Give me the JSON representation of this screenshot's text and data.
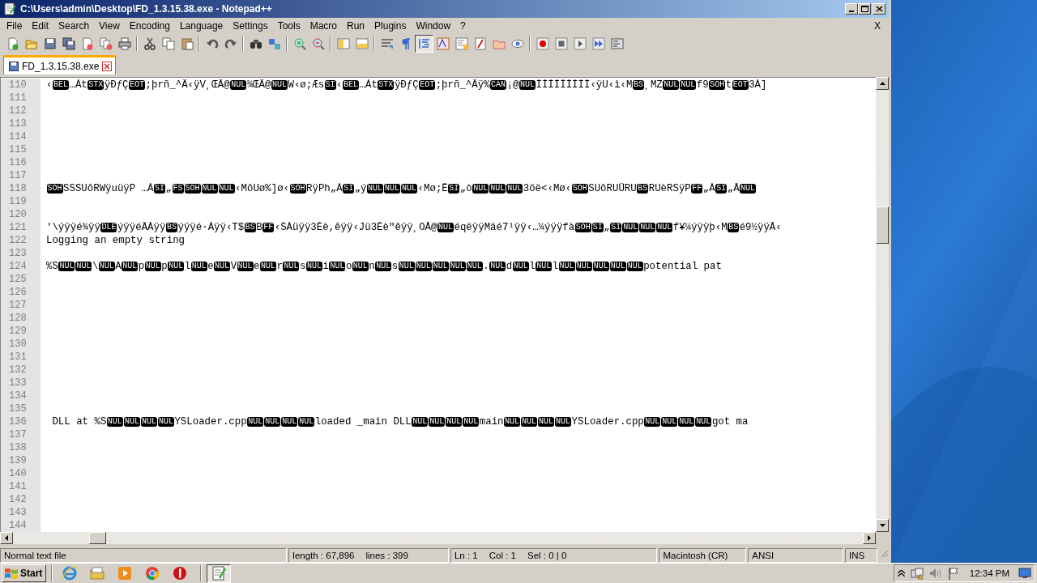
{
  "window": {
    "title": "C:\\Users\\admin\\Desktop\\FD_1.3.15.38.exe - Notepad++"
  },
  "menu": [
    "File",
    "Edit",
    "Search",
    "View",
    "Encoding",
    "Language",
    "Settings",
    "Tools",
    "Macro",
    "Run",
    "Plugins",
    "Window",
    "?"
  ],
  "menu_close": "X",
  "toolbar": [
    {
      "selected": false
    },
    {
      "selected": false
    },
    {
      "selected": false
    },
    {
      "selected": false
    },
    {
      "selected": false
    },
    {
      "selected": false
    },
    {
      "selected": false
    },
    {
      "selected": false
    },
    {
      "selected": false
    },
    {
      "selected": false
    },
    {
      "selected": false
    },
    {
      "selected": false
    },
    {
      "selected": false
    },
    {
      "selected": false
    },
    {
      "selected": false
    },
    {
      "selected": false
    },
    {
      "selected": false
    },
    {
      "selected": false
    },
    {
      "selected": false
    },
    {
      "selected": false
    },
    {
      "selected": true
    },
    {
      "selected": false
    },
    {
      "selected": false
    },
    {
      "selected": false
    },
    {
      "selected": false
    },
    {
      "selected": false
    },
    {
      "selected": false
    },
    {
      "selected": false
    },
    {
      "selected": false
    },
    {
      "selected": false
    },
    {
      "selected": false
    }
  ],
  "tabs": [
    {
      "label": "FD_1.3.15.38.exe",
      "selected": true
    }
  ],
  "lines": [
    {
      "number": "110",
      "segments": [
        {
          "kind": "text",
          "text": "‹"
        },
        {
          "kind": "ctrl",
          "text": "BEL"
        },
        {
          "kind": "text",
          "text": "…Àt"
        },
        {
          "kind": "ctrl",
          "text": "STX"
        },
        {
          "kind": "text",
          "text": "ÿÐƒÇ"
        },
        {
          "kind": "ctrl",
          "text": "EOT"
        },
        {
          "kind": "text",
          "text": ";þrñ_^Ã"
        },
        {
          "kind": "text",
          "text": "‹ÿV¸ŒÃ@"
        },
        {
          "kind": "ctrl",
          "text": "NUL"
        },
        {
          "kind": "text",
          "text": "¾ŒÃ@"
        },
        {
          "kind": "ctrl",
          "text": "NUL"
        },
        {
          "kind": "text",
          "text": "W‹ø;Æs"
        },
        {
          "kind": "ctrl",
          "text": "SI"
        },
        {
          "kind": "text",
          "text": "‹"
        },
        {
          "kind": "ctrl",
          "text": "BEL"
        },
        {
          "kind": "text",
          "text": "…Àt"
        },
        {
          "kind": "ctrl",
          "text": "STX"
        },
        {
          "kind": "text",
          "text": "ÿÐƒÇ"
        },
        {
          "kind": "ctrl",
          "text": "EOT"
        },
        {
          "kind": "text",
          "text": ";þrñ_^Ãÿ%"
        },
        {
          "kind": "ctrl",
          "text": "CAN"
        },
        {
          "kind": "text",
          "text": "¡@"
        },
        {
          "kind": "ctrl",
          "text": "NUL"
        },
        {
          "kind": "text",
          "text": "ÌÌÌÌÌÌÌÌÌ‹ÿU‹ì‹M"
        },
        {
          "kind": "ctrl",
          "text": "BS"
        },
        {
          "kind": "text",
          "text": "¸MZ"
        },
        {
          "kind": "ctrl",
          "text": "NUL"
        },
        {
          "kind": "ctrl",
          "text": "NUL"
        },
        {
          "kind": "text",
          "text": "f9"
        },
        {
          "kind": "ctrl",
          "text": "SOH"
        },
        {
          "kind": "text",
          "text": "t"
        },
        {
          "kind": "ctrl",
          "text": "EOT"
        },
        {
          "kind": "text",
          "text": "3À]"
        }
      ]
    },
    {
      "number": "111"
    },
    {
      "number": "112"
    },
    {
      "number": "113"
    },
    {
      "number": "114"
    },
    {
      "number": "115"
    },
    {
      "number": "116"
    },
    {
      "number": "117"
    },
    {
      "number": "118",
      "segments": [
        {
          "kind": "ctrl",
          "text": "SOH"
        },
        {
          "kind": "text",
          "text": "SSSUôRWÿuüÿP …À"
        },
        {
          "kind": "ctrl",
          "text": "SI"
        },
        {
          "kind": "text",
          "text": "„"
        },
        {
          "kind": "ctrl",
          "text": "FS"
        },
        {
          "kind": "ctrl",
          "text": "SOH"
        },
        {
          "kind": "ctrl",
          "text": "NUL"
        },
        {
          "kind": "ctrl",
          "text": "NUL"
        },
        {
          "kind": "text",
          "text": "‹MôUø%]ø‹"
        },
        {
          "kind": "ctrl",
          "text": "SOH"
        },
        {
          "kind": "text",
          "text": "RÿPh„À"
        },
        {
          "kind": "ctrl",
          "text": "SI"
        },
        {
          "kind": "text",
          "text": "„ý"
        },
        {
          "kind": "ctrl",
          "text": "NUL"
        },
        {
          "kind": "ctrl",
          "text": "NUL"
        },
        {
          "kind": "ctrl",
          "text": "NUL"
        },
        {
          "kind": "text",
          "text": "‹Mø;Ë"
        },
        {
          "kind": "ctrl",
          "text": "SI"
        },
        {
          "kind": "text",
          "text": "„ò"
        },
        {
          "kind": "ctrl",
          "text": "NUL"
        },
        {
          "kind": "ctrl",
          "text": "NUL"
        },
        {
          "kind": "ctrl",
          "text": "NUL"
        },
        {
          "kind": "text",
          "text": "3öë<‹Mø‹"
        },
        {
          "kind": "ctrl",
          "text": "SOH"
        },
        {
          "kind": "text",
          "text": "SUôRUÜRU"
        },
        {
          "kind": "ctrl",
          "text": "BS"
        },
        {
          "kind": "text",
          "text": "RUèRSÿP"
        },
        {
          "kind": "ctrl",
          "text": "FF"
        },
        {
          "kind": "text",
          "text": "„À"
        },
        {
          "kind": "ctrl",
          "text": "SI"
        },
        {
          "kind": "text",
          "text": "„Å"
        },
        {
          "kind": "ctrl",
          "text": "NUL"
        }
      ]
    },
    {
      "number": "119"
    },
    {
      "number": "120"
    },
    {
      "number": "121",
      "segments": [
        {
          "kind": "text",
          "text": "'\\ýÿÿé¾ÿÿ"
        },
        {
          "kind": "ctrl",
          "text": "DLE"
        },
        {
          "kind": "text",
          "text": "ýÿÿéÂÁÿÿ"
        },
        {
          "kind": "ctrl",
          "text": "BS"
        },
        {
          "kind": "text",
          "text": "ýÿÿé·Áÿÿ‹T$"
        },
        {
          "kind": "ctrl",
          "text": "BS"
        },
        {
          "kind": "text",
          "text": "B"
        },
        {
          "kind": "ctrl",
          "text": "FF"
        },
        {
          "kind": "text",
          "text": "‹ŠÀüÿÿ3Èè,êÿÿ‹Jü3Èè\"êÿÿ¸OÅ@"
        },
        {
          "kind": "ctrl",
          "text": "NUL"
        },
        {
          "kind": "text",
          "text": "éqëÿÿMäé7¹ÿÿ‹…¼ýÿÿfà"
        },
        {
          "kind": "ctrl",
          "text": "SOH"
        },
        {
          "kind": "ctrl",
          "text": "SI"
        },
        {
          "kind": "text",
          "text": "„"
        },
        {
          "kind": "ctrl",
          "text": "SI"
        },
        {
          "kind": "ctrl",
          "text": "NUL"
        },
        {
          "kind": "ctrl",
          "text": "NUL"
        },
        {
          "kind": "ctrl",
          "text": "NUL"
        },
        {
          "kind": "text",
          "text": "f¥¼ýÿÿþ‹M"
        },
        {
          "kind": "ctrl",
          "text": "BS"
        },
        {
          "kind": "text",
          "text": "é9½ÿÿÃ"
        },
        {
          "kind": "text",
          "text": "‹"
        }
      ]
    },
    {
      "number": "122",
      "segments": [
        {
          "kind": "text",
          "text": "Logging an empty string"
        }
      ]
    },
    {
      "number": "123"
    },
    {
      "number": "124",
      "segments": [
        {
          "kind": "text",
          "text": "%S"
        },
        {
          "kind": "ctrl",
          "text": "NUL"
        },
        {
          "kind": "ctrl",
          "text": "NUL"
        },
        {
          "kind": "text",
          "text": "\\"
        },
        {
          "kind": "ctrl",
          "text": "NUL"
        },
        {
          "kind": "text",
          "text": "A"
        },
        {
          "kind": "ctrl",
          "text": "NUL"
        },
        {
          "kind": "text",
          "text": "p"
        },
        {
          "kind": "ctrl",
          "text": "NUL"
        },
        {
          "kind": "text",
          "text": "p"
        },
        {
          "kind": "ctrl",
          "text": "NUL"
        },
        {
          "kind": "text",
          "text": "l"
        },
        {
          "kind": "ctrl",
          "text": "NUL"
        },
        {
          "kind": "text",
          "text": "e"
        },
        {
          "kind": "ctrl",
          "text": "NUL"
        },
        {
          "kind": "text",
          "text": "V"
        },
        {
          "kind": "ctrl",
          "text": "NUL"
        },
        {
          "kind": "text",
          "text": "e"
        },
        {
          "kind": "ctrl",
          "text": "NUL"
        },
        {
          "kind": "text",
          "text": "r"
        },
        {
          "kind": "ctrl",
          "text": "NUL"
        },
        {
          "kind": "text",
          "text": "s"
        },
        {
          "kind": "ctrl",
          "text": "NUL"
        },
        {
          "kind": "text",
          "text": "i"
        },
        {
          "kind": "ctrl",
          "text": "NUL"
        },
        {
          "kind": "text",
          "text": "o"
        },
        {
          "kind": "ctrl",
          "text": "NUL"
        },
        {
          "kind": "text",
          "text": "n"
        },
        {
          "kind": "ctrl",
          "text": "NUL"
        },
        {
          "kind": "text",
          "text": "s"
        },
        {
          "kind": "ctrl",
          "text": "NUL"
        },
        {
          "kind": "ctrl",
          "text": "NUL"
        },
        {
          "kind": "ctrl",
          "text": "NUL"
        },
        {
          "kind": "ctrl",
          "text": "NUL"
        },
        {
          "kind": "ctrl",
          "text": "NUL"
        },
        {
          "kind": "text",
          "text": "."
        },
        {
          "kind": "ctrl",
          "text": "NUL"
        },
        {
          "kind": "text",
          "text": "d"
        },
        {
          "kind": "ctrl",
          "text": "NUL"
        },
        {
          "kind": "text",
          "text": "l"
        },
        {
          "kind": "ctrl",
          "text": "NUL"
        },
        {
          "kind": "text",
          "text": "l"
        },
        {
          "kind": "ctrl",
          "text": "NUL"
        },
        {
          "kind": "ctrl",
          "text": "NUL"
        },
        {
          "kind": "ctrl",
          "text": "NUL"
        },
        {
          "kind": "ctrl",
          "text": "NUL"
        },
        {
          "kind": "ctrl",
          "text": "NUL"
        },
        {
          "kind": "text",
          "text": "potential pat"
        }
      ]
    },
    {
      "number": "125"
    },
    {
      "number": "126"
    },
    {
      "number": "127"
    },
    {
      "number": "128"
    },
    {
      "number": "129"
    },
    {
      "number": "130"
    },
    {
      "number": "131"
    },
    {
      "number": "132"
    },
    {
      "number": "133"
    },
    {
      "number": "134"
    },
    {
      "number": "135"
    },
    {
      "number": "136",
      "segments": [
        {
          "kind": "text",
          "text": " DLL at %S"
        },
        {
          "kind": "ctrl",
          "text": "NUL"
        },
        {
          "kind": "ctrl",
          "text": "NUL"
        },
        {
          "kind": "ctrl",
          "text": "NUL"
        },
        {
          "kind": "ctrl",
          "text": "NUL"
        },
        {
          "kind": "text",
          "text": "YSLoader.cpp"
        },
        {
          "kind": "ctrl",
          "text": "NUL"
        },
        {
          "kind": "ctrl",
          "text": "NUL"
        },
        {
          "kind": "ctrl",
          "text": "NUL"
        },
        {
          "kind": "ctrl",
          "text": "NUL"
        },
        {
          "kind": "text",
          "text": "loaded _main DLL"
        },
        {
          "kind": "ctrl",
          "text": "NUL"
        },
        {
          "kind": "ctrl",
          "text": "NUL"
        },
        {
          "kind": "ctrl",
          "text": "NUL"
        },
        {
          "kind": "ctrl",
          "text": "NUL"
        },
        {
          "kind": "text",
          "text": "main"
        },
        {
          "kind": "ctrl",
          "text": "NUL"
        },
        {
          "kind": "ctrl",
          "text": "NUL"
        },
        {
          "kind": "ctrl",
          "text": "NUL"
        },
        {
          "kind": "ctrl",
          "text": "NUL"
        },
        {
          "kind": "text",
          "text": "YSLoader.cpp"
        },
        {
          "kind": "ctrl",
          "text": "NUL"
        },
        {
          "kind": "ctrl",
          "text": "NUL"
        },
        {
          "kind": "ctrl",
          "text": "NUL"
        },
        {
          "kind": "ctrl",
          "text": "NUL"
        },
        {
          "kind": "text",
          "text": "got ma"
        }
      ]
    },
    {
      "number": "137"
    },
    {
      "number": "138"
    },
    {
      "number": "139"
    },
    {
      "number": "140"
    },
    {
      "number": "141"
    },
    {
      "number": "142"
    },
    {
      "number": "143"
    },
    {
      "number": "144"
    }
  ],
  "status_bar": {
    "file_type": "Normal text file",
    "length": "length : 67,896",
    "lines": "lines : 399",
    "line": "Ln : 1",
    "column": "Col : 1",
    "selection": "Sel : 0 | 0",
    "eol": "Macintosh (CR)",
    "encoding": "ANSI",
    "mode": "INS"
  },
  "taskbar": {
    "start": "Start",
    "apps": [
      {
        "selected": false
      },
      {
        "selected": false
      },
      {
        "selected": false
      },
      {
        "selected": false
      },
      {
        "selected": false
      },
      {
        "selected": true
      }
    ],
    "clock": "12:34 PM"
  }
}
